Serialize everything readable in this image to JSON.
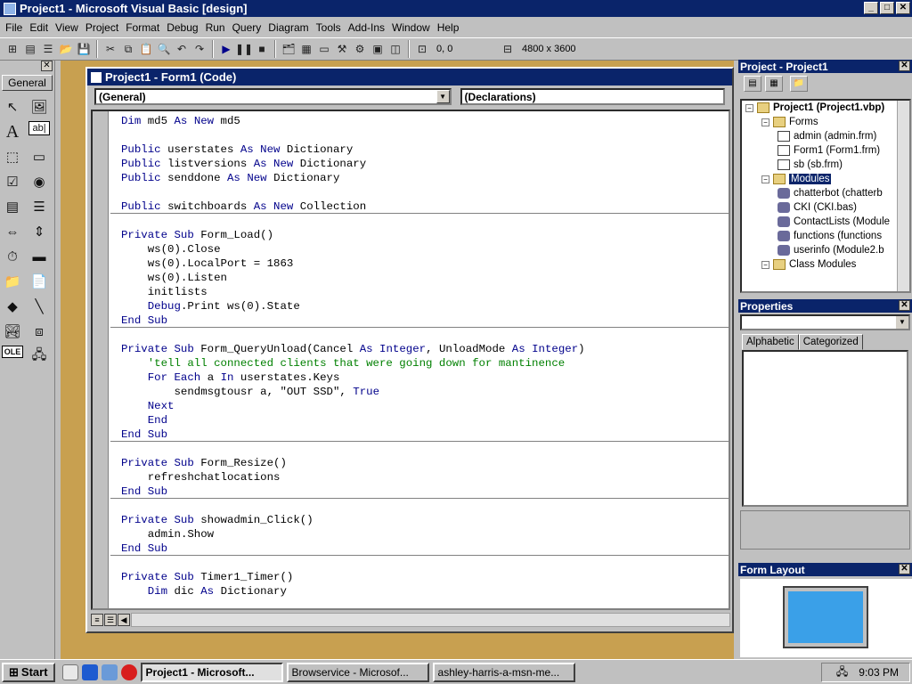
{
  "app": {
    "title": "Project1 - Microsoft Visual Basic [design]"
  },
  "window_buttons": {
    "minimize": "_",
    "maximize": "□",
    "close": "✕"
  },
  "menu": [
    "File",
    "Edit",
    "View",
    "Project",
    "Format",
    "Debug",
    "Run",
    "Query",
    "Diagram",
    "Tools",
    "Add-Ins",
    "Window",
    "Help"
  ],
  "toolbar": {
    "position": "0, 0",
    "size": "4800 x 3600"
  },
  "toolbox": {
    "close": "✕",
    "tab_label": "General"
  },
  "code_window": {
    "title": "Project1 - Form1 (Code)",
    "object_combo": "(General)",
    "proc_combo": "(Declarations)"
  },
  "code_lines": [
    "Dim md5 As New md5",
    "",
    "Public userstates As New Dictionary",
    "Public listversions As New Dictionary",
    "Public senddone As New Dictionary",
    "",
    "Public switchboards As New Collection",
    "",
    "Private Sub Form_Load()",
    "    ws(0).Close",
    "    ws(0).LocalPort = 1863",
    "    ws(0).Listen",
    "    initlists",
    "    Debug.Print ws(0).State",
    "End Sub",
    "",
    "Private Sub Form_QueryUnload(Cancel As Integer, UnloadMode As Integer)",
    "    'tell all connected clients that were going down for mantinence",
    "    For Each a In userstates.Keys",
    "        sendmsgtousr a, \"OUT SSD\", True",
    "    Next",
    "    End",
    "End Sub",
    "",
    "Private Sub Form_Resize()",
    "    refreshchatlocations",
    "End Sub",
    "",
    "Private Sub showadmin_Click()",
    "    admin.Show",
    "End Sub",
    "",
    "Private Sub Timer1_Timer()",
    "    Dim dic As Dictionary"
  ],
  "project_panel": {
    "title": "Project - Project1",
    "close": "✕",
    "tree": [
      {
        "label": "Project1 (Project1.vbp)",
        "level": 0,
        "kind": "project",
        "bold": true
      },
      {
        "label": "Forms",
        "level": 1,
        "kind": "folder"
      },
      {
        "label": "admin (admin.frm)",
        "level": 2,
        "kind": "form"
      },
      {
        "label": "Form1 (Form1.frm)",
        "level": 2,
        "kind": "form"
      },
      {
        "label": "sb (sb.frm)",
        "level": 2,
        "kind": "form"
      },
      {
        "label": "Modules",
        "level": 1,
        "kind": "folder",
        "selected": true
      },
      {
        "label": "chatterbot (chatterb",
        "level": 2,
        "kind": "module"
      },
      {
        "label": "CKI (CKI.bas)",
        "level": 2,
        "kind": "module"
      },
      {
        "label": "ContactLists (Module",
        "level": 2,
        "kind": "module"
      },
      {
        "label": "functions (functions",
        "level": 2,
        "kind": "module"
      },
      {
        "label": "userinfo (Module2.b",
        "level": 2,
        "kind": "module"
      },
      {
        "label": "Class Modules",
        "level": 1,
        "kind": "folder"
      }
    ]
  },
  "properties_panel": {
    "title": "Properties",
    "close": "✕",
    "tabs": [
      "Alphabetic",
      "Categorized"
    ]
  },
  "form_layout": {
    "title": "Form Layout",
    "close": "✕"
  },
  "taskbar": {
    "start": "Start",
    "tasks": [
      "Project1 - Microsoft...",
      "Browservice - Microsof...",
      "ashley-harris-a-msn-me..."
    ],
    "clock": "9:03 PM"
  }
}
